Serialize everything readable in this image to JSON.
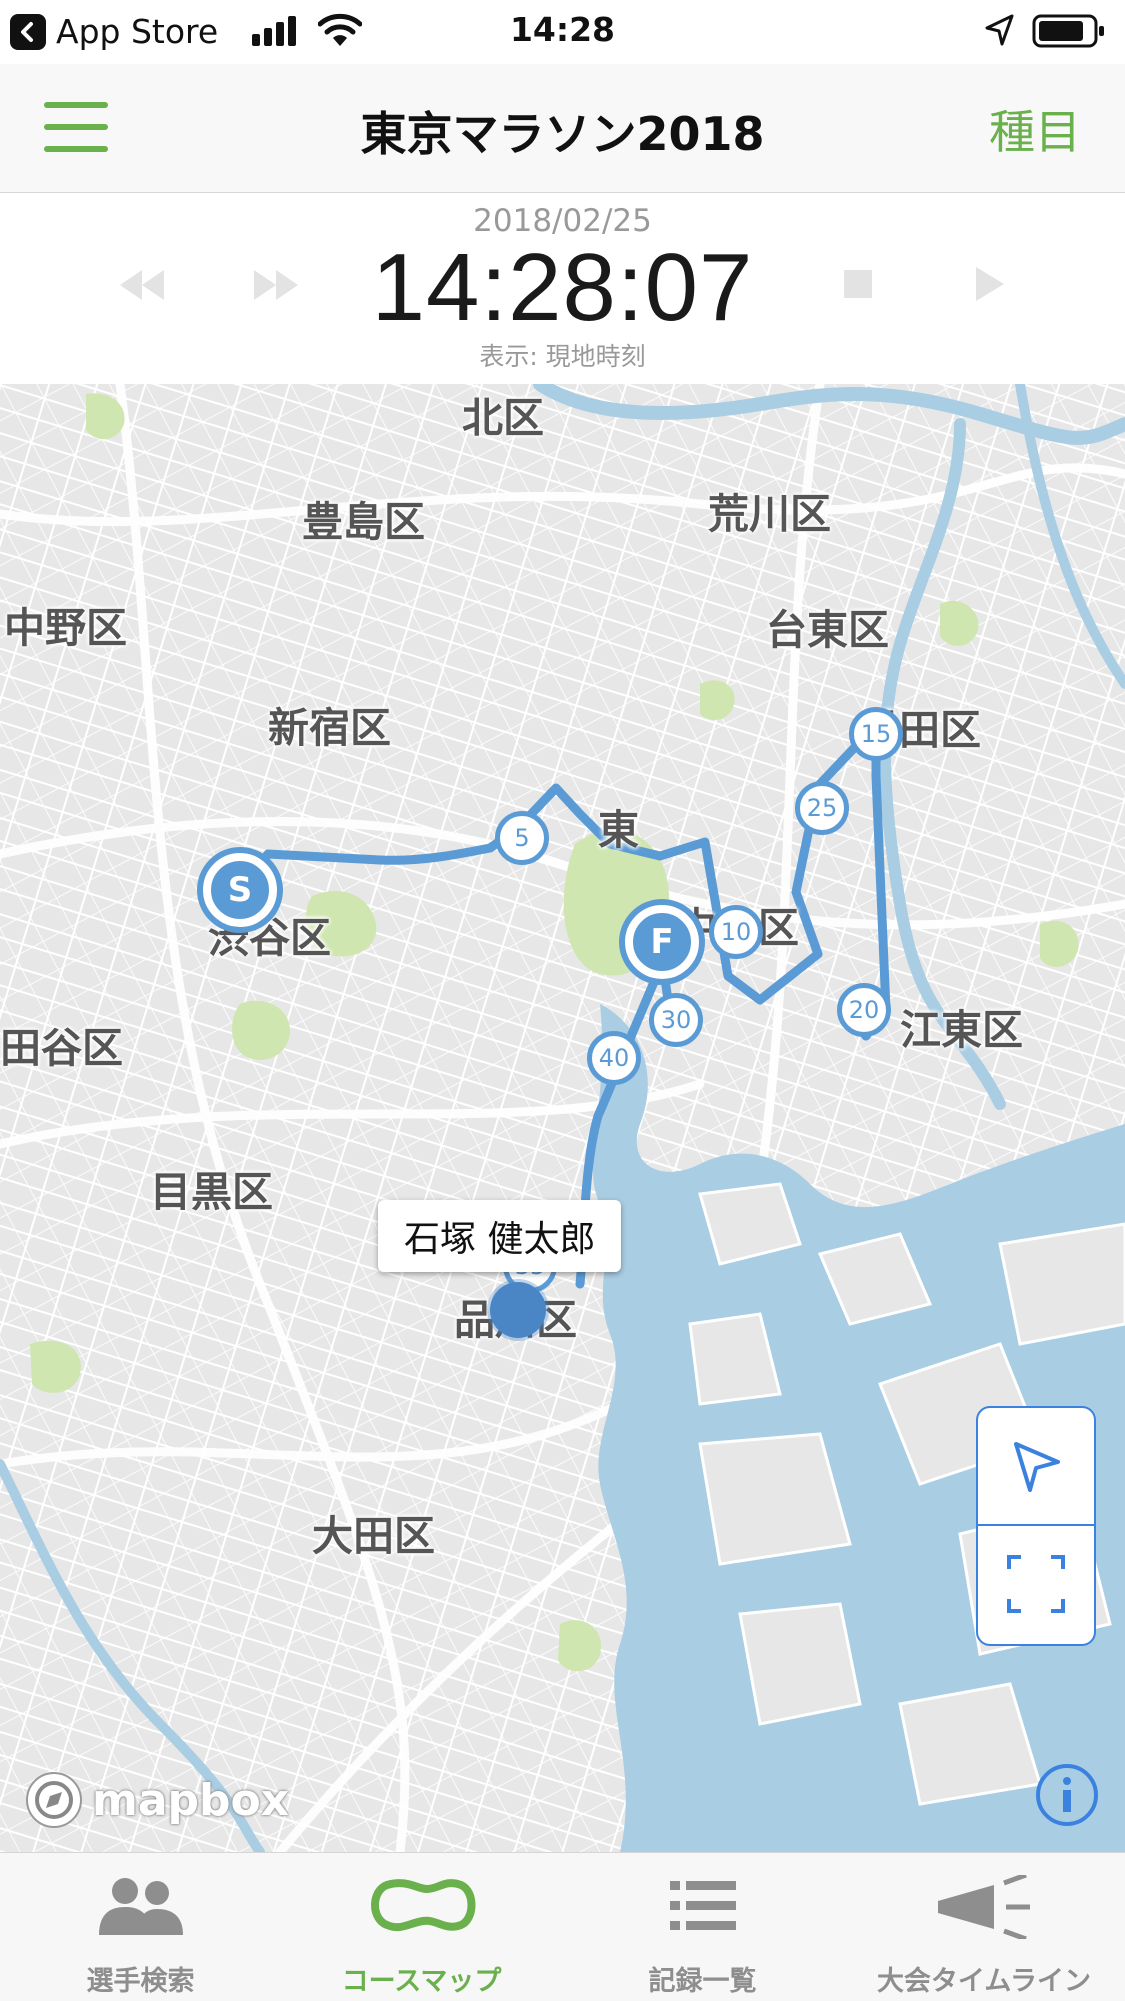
{
  "status_bar": {
    "back_app": "App Store",
    "time": "14:28"
  },
  "nav": {
    "title": "東京マラソン2018",
    "right_button": "種目"
  },
  "time_panel": {
    "date": "2018/02/25",
    "time": "14:28:07",
    "timezone_label": "表示: 現地時刻"
  },
  "map": {
    "wards": [
      "北区",
      "豊島区",
      "荒川区",
      "中野区",
      "台東区",
      "新宿区",
      "墨田区",
      "渋谷区",
      "中央区",
      "江東区",
      "田谷区",
      "目黒区",
      "品川区",
      "大田区",
      "東"
    ],
    "start_marker": "S",
    "finish_marker": "F",
    "km_markers": [
      "5",
      "10",
      "15",
      "20",
      "25",
      "30",
      "35",
      "40"
    ],
    "runner_name": "石塚 健太郎",
    "attribution": "mapbox",
    "route_color": "#5b9bd5"
  },
  "tabs": [
    {
      "label": "選手検索",
      "icon": "people-icon",
      "active": false
    },
    {
      "label": "コースマップ",
      "icon": "course-loop-icon",
      "active": true
    },
    {
      "label": "記録一覧",
      "icon": "list-icon",
      "active": false
    },
    {
      "label": "大会タイムライン",
      "icon": "megaphone-icon",
      "active": false
    }
  ],
  "colors": {
    "accent_green": "#6ab04c",
    "route_blue": "#5b9bd5",
    "water": "#a9cde3",
    "park": "#cfe6b0"
  }
}
